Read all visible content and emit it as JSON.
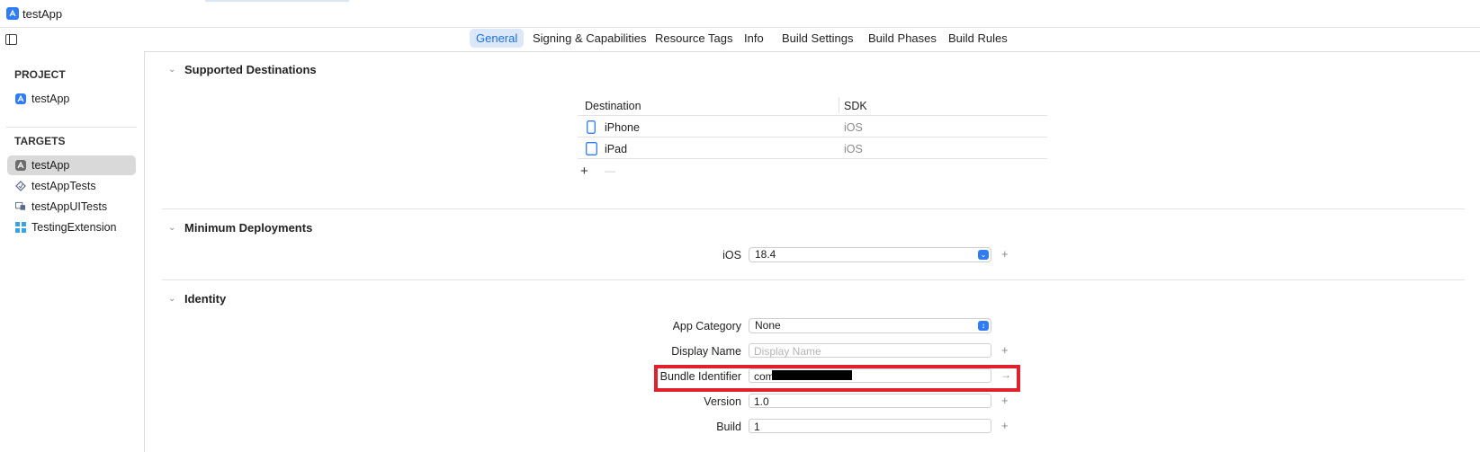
{
  "window": {
    "title": "testApp"
  },
  "tabs": [
    {
      "label": "General",
      "active": true
    },
    {
      "label": "Signing & Capabilities",
      "active": false
    },
    {
      "label": "Resource Tags",
      "active": false
    },
    {
      "label": "Info",
      "active": false
    },
    {
      "label": "Build Settings",
      "active": false
    },
    {
      "label": "Build Phases",
      "active": false
    },
    {
      "label": "Build Rules",
      "active": false
    }
  ],
  "sidebar": {
    "project_heading": "PROJECT",
    "project_item": "testApp",
    "targets_heading": "TARGETS",
    "targets": [
      {
        "label": "testApp",
        "icon": "app-target-icon",
        "selected": true
      },
      {
        "label": "testAppTests",
        "icon": "test-target-icon",
        "selected": false
      },
      {
        "label": "testAppUITests",
        "icon": "ui-test-target-icon",
        "selected": false
      },
      {
        "label": "TestingExtension",
        "icon": "extension-target-icon",
        "selected": false
      }
    ]
  },
  "supported_destinations": {
    "title": "Supported Destinations",
    "columns": [
      "Destination",
      "SDK"
    ],
    "rows": [
      {
        "destination": "iPhone",
        "sdk": "iOS",
        "icon": "iphone-icon"
      },
      {
        "destination": "iPad",
        "sdk": "iOS",
        "icon": "ipad-icon"
      }
    ],
    "add": "+",
    "remove": "—"
  },
  "minimum_deployments": {
    "title": "Minimum Deployments",
    "label": "iOS",
    "value": "18.4"
  },
  "identity": {
    "title": "Identity",
    "app_category_label": "App Category",
    "app_category_value": "None",
    "display_name_label": "Display Name",
    "display_name_placeholder": "Display Name",
    "bundle_identifier_label": "Bundle Identifier",
    "bundle_identifier_value": "com",
    "version_label": "Version",
    "version_value": "1.0",
    "build_label": "Build",
    "build_value": "1"
  },
  "colors": {
    "accent": "#2f7cf6",
    "highlight": "#e0202a",
    "active_tab_bg": "#dbe8f7"
  }
}
